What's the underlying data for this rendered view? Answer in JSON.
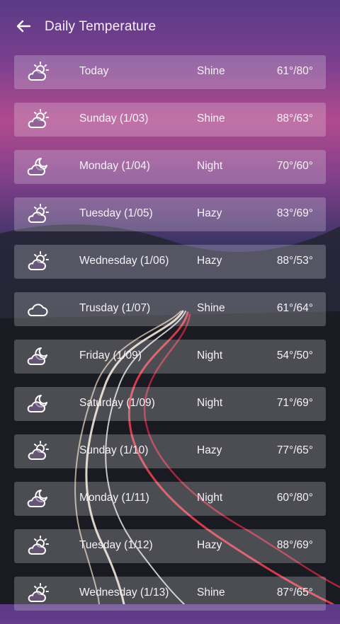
{
  "header": {
    "title": "Daily Temperature"
  },
  "days": [
    {
      "label": "Today",
      "condition": "Shine",
      "temp": "61°/80°",
      "icon": "sun-cloud-icon"
    },
    {
      "label": "Sunday (1/03)",
      "condition": "Shine",
      "temp": "88°/63°",
      "icon": "sun-cloud-icon"
    },
    {
      "label": "Monday (1/04)",
      "condition": "Night",
      "temp": "70°/60°",
      "icon": "moon-cloud-icon"
    },
    {
      "label": "Tuesday (1/05)",
      "condition": "Hazy",
      "temp": "83°/69°",
      "icon": "sun-cloud-icon"
    },
    {
      "label": "Wednesday (1/06)",
      "condition": "Hazy",
      "temp": "88°/53°",
      "icon": "sun-cloud-icon"
    },
    {
      "label": "Trusday (1/07)",
      "condition": "Shine",
      "temp": "61°/64°",
      "icon": "cloud-icon"
    },
    {
      "label": "Friday (1/09)",
      "condition": "Night",
      "temp": "54°/50°",
      "icon": "moon-cloud-icon"
    },
    {
      "label": "Saturday (1/09)",
      "condition": "Night",
      "temp": "71°/69°",
      "icon": "moon-cloud-icon"
    },
    {
      "label": "Sunday (1/10)",
      "condition": "Hazy",
      "temp": "77°/65°",
      "icon": "sun-cloud-icon"
    },
    {
      "label": "Monday (1/11)",
      "condition": "Night",
      "temp": "60°/80°",
      "icon": "moon-cloud-icon"
    },
    {
      "label": "Tuesday (1/12)",
      "condition": "Hazy",
      "temp": "88°/69°",
      "icon": "sun-cloud-icon"
    },
    {
      "label": "Wednesday (1/13)",
      "condition": "Shine",
      "temp": "87°/65°",
      "icon": "sun-cloud-icon"
    }
  ]
}
